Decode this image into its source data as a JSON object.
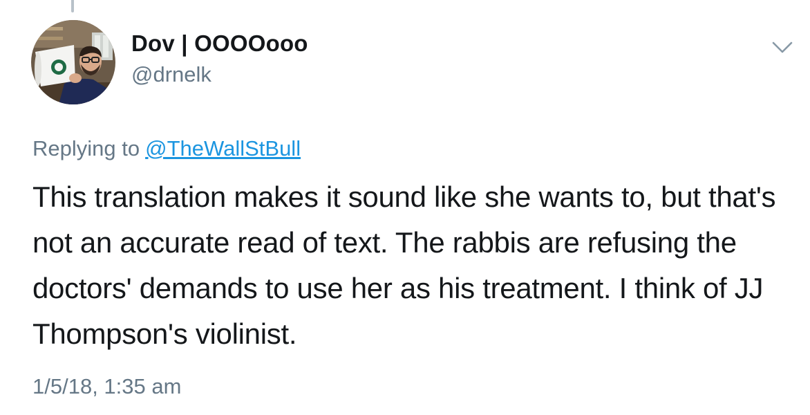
{
  "tweet": {
    "author": {
      "display_name": "Dov | OOOOooo",
      "handle": "@drnelk",
      "avatar_icon": "profile-photo"
    },
    "menu_icon": "chevron-down-icon",
    "replying_prefix": "Replying to",
    "replying_to": "@TheWallStBull",
    "text": "This translation makes it sound like she wants to, but that's not an accurate read of text. The rabbis are refusing the doctors' demands to use her as his treatment. I think of JJ Thompson's violinist.",
    "timestamp": "1/5/18, 1:35 am"
  },
  "colors": {
    "primary_text": "#14171a",
    "secondary_text": "#657786",
    "link": "#1b95e0",
    "thread_line": "#b8c1c9"
  }
}
